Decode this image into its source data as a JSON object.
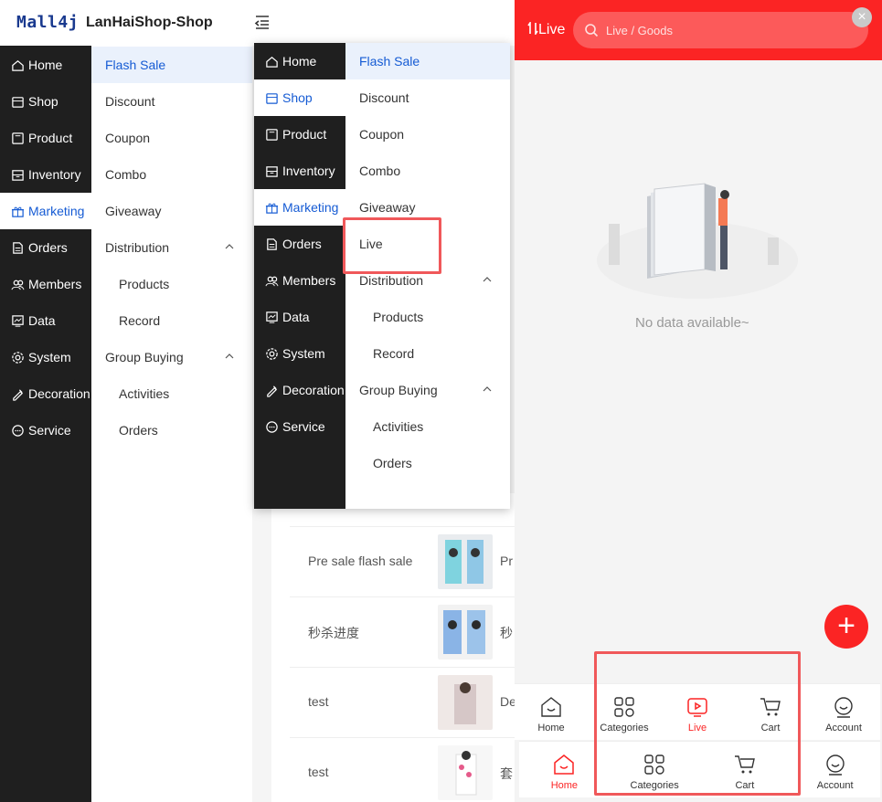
{
  "header": {
    "logo": "Mall4j",
    "shop_name": "LanHaiShop-Shop"
  },
  "nav": [
    {
      "label": "Home",
      "icon": "home-icon"
    },
    {
      "label": "Shop",
      "icon": "shop-icon"
    },
    {
      "label": "Product",
      "icon": "product-icon"
    },
    {
      "label": "Inventory",
      "icon": "inventory-icon"
    },
    {
      "label": "Marketing",
      "icon": "gift-icon"
    },
    {
      "label": "Orders",
      "icon": "orders-icon"
    },
    {
      "label": "Members",
      "icon": "members-icon"
    },
    {
      "label": "Data",
      "icon": "data-icon"
    },
    {
      "label": "System",
      "icon": "settings-icon"
    },
    {
      "label": "Decoration",
      "icon": "decoration-icon"
    },
    {
      "label": "Service",
      "icon": "service-icon"
    }
  ],
  "subnav": [
    "Flash Sale",
    "Discount",
    "Coupon",
    "Combo",
    "Giveaway",
    "Distribution",
    "Products",
    "Record",
    "Group Buying",
    "Activities",
    "Orders"
  ],
  "popup": {
    "subnav": [
      "Flash Sale",
      "Discount",
      "Coupon",
      "Combo",
      "Giveaway",
      "Live",
      "Distribution",
      "Products",
      "Record",
      "Group Buying",
      "Activities",
      "Orders"
    ]
  },
  "table_rows": [
    {
      "name": "Pre sale flash sale",
      "trail": "Pr"
    },
    {
      "name": "秒杀进度",
      "trail": "秒"
    },
    {
      "name": "test",
      "trail": "De"
    },
    {
      "name": "test",
      "trail": "套"
    }
  ],
  "phone": {
    "title": "Live",
    "search_placeholder": "Live / Goods",
    "empty_text": "No data available~",
    "tabbar_top": [
      "Home",
      "Categories",
      "Live",
      "Cart",
      "Account"
    ],
    "tabbar_bottom": [
      "Home",
      "Categories",
      "Cart",
      "Account"
    ]
  },
  "colors": {
    "accent": "#155bd4",
    "brand_red": "#fb2424",
    "highlight": "#f0585a",
    "nav_bg": "#1f1f1f"
  }
}
